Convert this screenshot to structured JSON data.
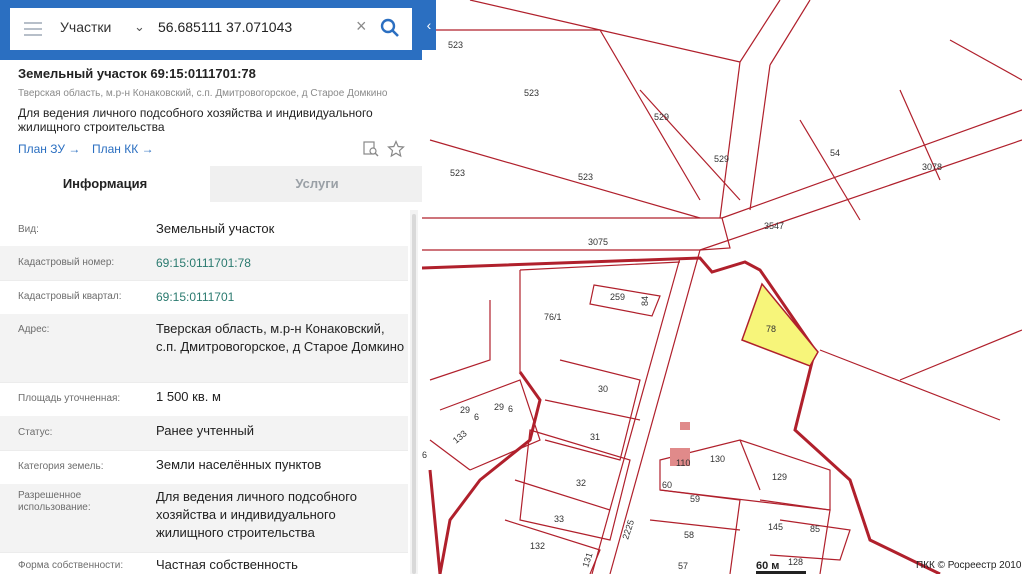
{
  "search": {
    "type_label": "Участки",
    "query": "56.685111 37.071043"
  },
  "parcel": {
    "title": "Земельный участок 69:15:0111701:78",
    "address_short": "Тверская область, м.р-н Конаковский, с.п. Дмитровогорское, д Старое Домкино",
    "purpose": "Для ведения личного подсобного хозяйства и индивидуального жилищного строительства",
    "plan_zu_link": "План ЗУ →",
    "plan_kk_link": "План КК →"
  },
  "tabs": [
    {
      "label": "Информация"
    },
    {
      "label": "Услуги"
    }
  ],
  "info": [
    {
      "label": "Вид:",
      "value": "Земельный участок"
    },
    {
      "label": "Кадастровый номер:",
      "value": "69:15:0111701:78"
    },
    {
      "label": "Кадастровый квартал:",
      "value": "69:15:0111701"
    },
    {
      "label": "Адрес:",
      "value": "Тверская область, м.р-н Конаковский, с.п. Дмитровогорское, д Старое Домкино"
    },
    {
      "label": "Площадь уточненная:",
      "value": "1 500 кв. м"
    },
    {
      "label": "Статус:",
      "value": "Ранее учтенный"
    },
    {
      "label": "Категория земель:",
      "value": "Земли населённых пунктов"
    },
    {
      "label": "Разрешенное использование:",
      "value": "Для ведения личного подсобного хозяйства и индивидуального жилищного строительства"
    },
    {
      "label": "Форма собственности:",
      "value": "Частная собственность"
    }
  ],
  "map": {
    "labels": [
      "523",
      "523",
      "529",
      "529",
      "54",
      "3078",
      "523",
      "523",
      "3547",
      "3075",
      "259",
      "84",
      "76/1",
      "78",
      "30",
      "29",
      "6",
      "29",
      "6",
      "133",
      "31",
      "6",
      "110",
      "130",
      "129",
      "60",
      "59",
      "32",
      "33",
      "58",
      "145",
      "85",
      "132",
      "2225",
      "57",
      "128",
      "131"
    ],
    "highlight_color": "#f7f57a",
    "boundary_color": "#b0202c",
    "scale_label": "60 м",
    "copyright": "ПКК © Росреестр 2010"
  }
}
